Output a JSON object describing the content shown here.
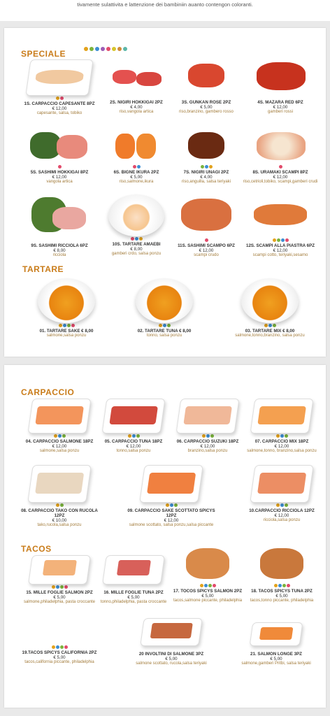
{
  "top_note": "tivamente sulattivita e lattenzione dei bambiniin auanto contengon coloranti.",
  "colors": {
    "accent": "#c97c1a",
    "desc": "#a27b3a",
    "badge": [
      "#e3a21c",
      "#7bb33c",
      "#3c8ed3",
      "#9c5db5",
      "#e24b6b",
      "#d6c52b",
      "#d08c3a",
      "#5bb7a8"
    ]
  },
  "sections": {
    "speciale": "SPECIALE",
    "tartare": "TARTARE",
    "carpaccio": "CARPACCIO",
    "tacos": "TACOS"
  },
  "speciale_items": [
    {
      "name": "1S. CARPACCIO CAPESANTE 8PZ",
      "price": "€ 12,00",
      "desc": "capesante, salsa, tobiko"
    },
    {
      "name": "2S. NIGIRI HOKKIGAI 2PZ",
      "price": "€ 4,00",
      "desc": "riso,vangola artica"
    },
    {
      "name": "3S. GUNKAN ROSE 2PZ",
      "price": "€ 5,00",
      "desc": "riso,branzino, gambero rosso"
    },
    {
      "name": "4S. MAZARA RED 6PZ",
      "price": "€ 12,00",
      "desc": "gamberi rossi"
    },
    {
      "name": "5S. SASHIMI HOKKIGAI 8PZ",
      "price": "€ 12,00",
      "desc": "vangola artica"
    },
    {
      "name": "6S. BIGNE IKURA 2PZ",
      "price": "€ 5,00",
      "desc": "riso,salmone,ikura"
    },
    {
      "name": "7S. NIGIRI UNAGI 2PZ",
      "price": "€ 4,00",
      "desc": "riso,anguilla, salsa teriyaki"
    },
    {
      "name": "8S. URAMAKI SCAMPI 8PZ",
      "price": "€ 12,00",
      "desc": "riso,cetrioli,tobiko, scampi,gamberi crudi"
    },
    {
      "name": "9S. SASHIMI RICCIOLA 6PZ",
      "price": "€ 8,00",
      "desc": "ricciola"
    },
    {
      "name": "10S. TARTARE AMAEBI",
      "price": "€ 8,00",
      "desc": "gamberi crdo, salsa ponzu"
    },
    {
      "name": "11S. SASHIMI SCAMPO 6PZ",
      "price": "€ 12,00",
      "desc": "scampi crudo"
    },
    {
      "name": "12S. SCAMPI ALLA PIASTRA 6PZ",
      "price": "€ 12,00",
      "desc": "scampi cotto, teriyaki,sesamo"
    }
  ],
  "tartare_items": [
    {
      "name": "01. TARTARE SAKE € 8,00",
      "desc": "salmone,salsa ponzu"
    },
    {
      "name": "02. TARTARE TUNA € 8,00",
      "desc": "tonno, salsa ponzu"
    },
    {
      "name": "03. TARTARE MIX € 8,00",
      "desc": "salmone,tonno,branzino, salsa ponzu"
    }
  ],
  "carpaccio_items": [
    {
      "name": "04. CARPACCIO SALMONE 18PZ",
      "price": "€ 12,00",
      "desc": "salmone,salsa ponzu"
    },
    {
      "name": "05. CARPACCIO TUNA 18PZ",
      "price": "€ 12,00",
      "desc": "tonno,salsa ponzu"
    },
    {
      "name": "06. CARPACCIO SUZUKI 18PZ",
      "price": "€ 12,00",
      "desc": "branzino,salsa ponzu"
    },
    {
      "name": "07. CARPACCIO MIX 18PZ",
      "price": "€ 12,00",
      "desc": "salmone,tonno, branzino,salsa ponzu"
    },
    {
      "name": "08. CARPACCIO TAKO CON RUCOLA 12PZ",
      "price": "€ 10,00",
      "desc": "tako,rucola,salsa ponzu"
    },
    {
      "name": "09. CARPACCIO SAKE SCOTTATO SPICYS 12PZ",
      "price": "€ 12,00",
      "desc": "salmone scottato, salsa ponzu,salsa piccante"
    },
    {
      "name": "10.CARPACCIO RICCIOLA 12PZ",
      "price": "€ 12,00",
      "desc": "ricciola,salsa ponzu"
    }
  ],
  "tacos_items": [
    {
      "name": "15. MILLE FOGLIE SALMON 2PZ",
      "price": "€ 5,00",
      "desc": "salmone,philadelphia, pasta croccante"
    },
    {
      "name": "16. MILLE FOGLIE TUNA 2PZ",
      "price": "€ 5,00",
      "desc": "tonno,philadelphia, pasta croccante"
    },
    {
      "name": "17. TOCOS SPICYS SALMON 2PZ",
      "price": "€ 5,00",
      "desc": "tacos,salmone piccante, philadelphia"
    },
    {
      "name": "18. TACOS SPICYS TUNA 2PZ",
      "price": "€ 5,00",
      "desc": "tacos,tonno piccante, philadelphia"
    },
    {
      "name": "19.TACOS SPICYS CALIFORNIA 2PZ",
      "price": "€ 5,00",
      "desc": "tacos,california piccante, philadelphia"
    },
    {
      "name": "20 INVOLTINI DI SALMONE 3PZ",
      "price": "€ 5,00",
      "desc": "salmone scottato, rucola,salsa teriyaki"
    },
    {
      "name": "21. SALMON LONGE 3PZ",
      "price": "€ 5,00",
      "desc": "salmone,gamberi Pritbi, salsa teriyaki"
    }
  ]
}
